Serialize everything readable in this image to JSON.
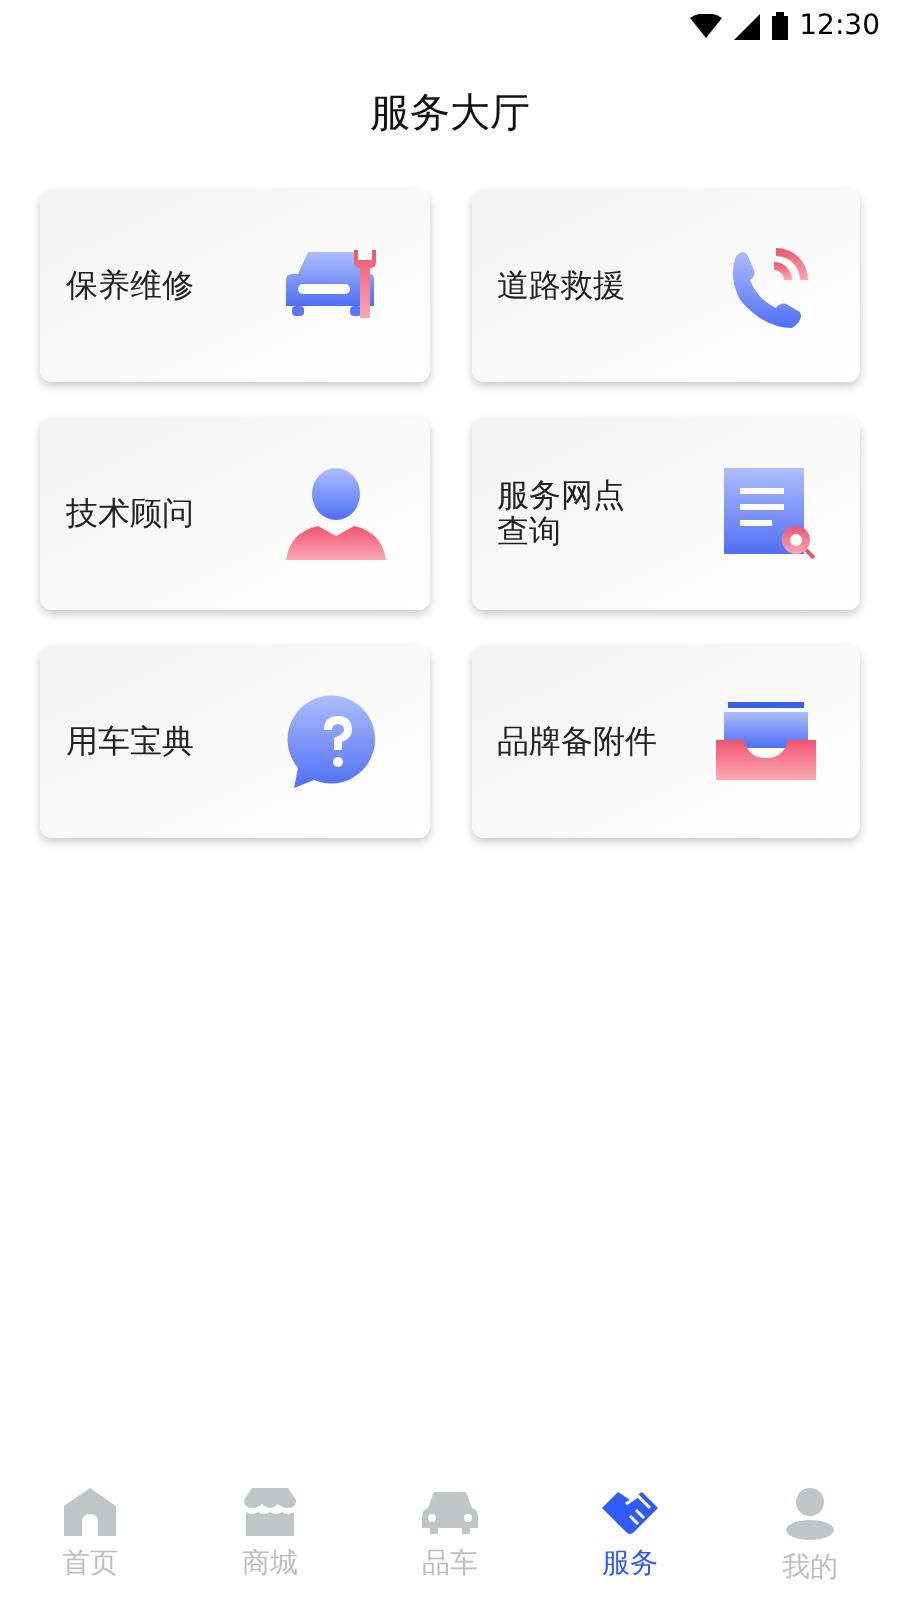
{
  "status_bar": {
    "time": "12:30"
  },
  "title": "服务大厅",
  "services": [
    {
      "label": "保养维修",
      "kind": "car-repair"
    },
    {
      "label": "道路救援",
      "kind": "phone"
    },
    {
      "label": "技术顾问",
      "kind": "advisor"
    },
    {
      "label": "服务网点查询",
      "kind": "document-search"
    },
    {
      "label": "用车宝典",
      "kind": "question"
    },
    {
      "label": "品牌备附件",
      "kind": "tray"
    }
  ],
  "tab_bar": [
    {
      "label": "首页",
      "kind": "home",
      "selected": false
    },
    {
      "label": "商城",
      "kind": "store",
      "selected": false
    },
    {
      "label": "品车",
      "kind": "car",
      "selected": false
    },
    {
      "label": "服务",
      "kind": "handshake",
      "selected": true
    },
    {
      "label": "我的",
      "kind": "user",
      "selected": false
    }
  ]
}
